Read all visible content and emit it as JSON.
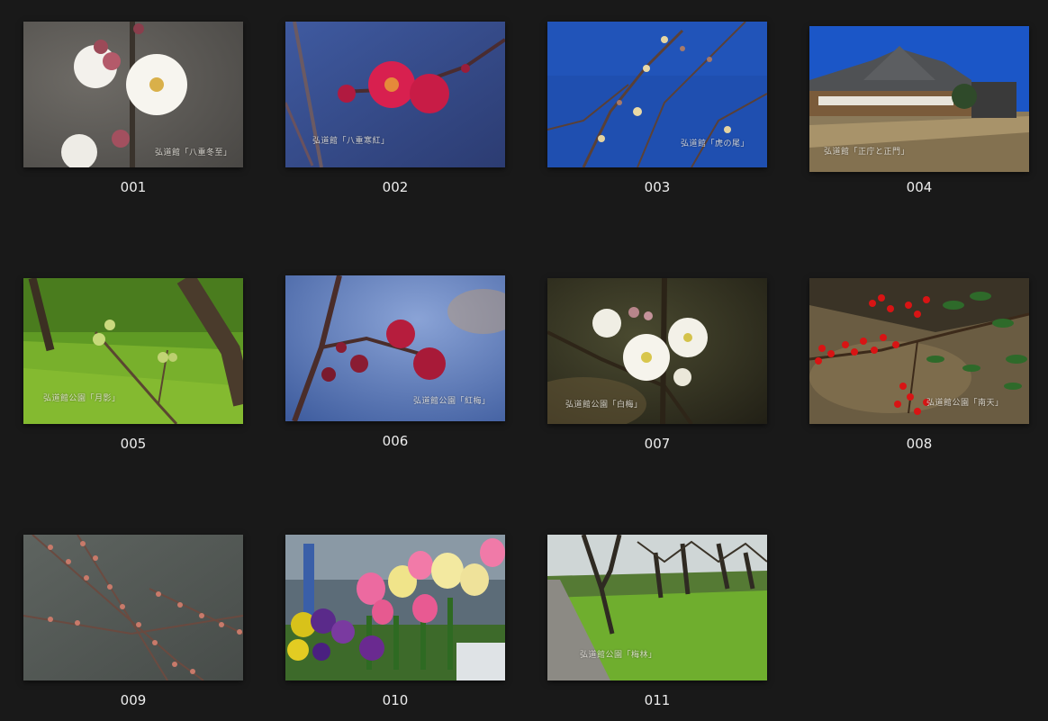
{
  "theme": {
    "background": "#191919",
    "label_color": "#ececec"
  },
  "gallery": {
    "items": [
      {
        "label": "001",
        "caption": "弘道館「八重冬至」",
        "subject": "white-plum-blossom"
      },
      {
        "label": "002",
        "caption": "弘道館「八重寒紅」",
        "subject": "red-plum-blossom"
      },
      {
        "label": "003",
        "caption": "弘道館「虎の尾」",
        "subject": "plum-buds-blue-sky"
      },
      {
        "label": "004",
        "caption": "弘道館「正庁と正門」",
        "subject": "kodokan-building"
      },
      {
        "label": "005",
        "caption": "弘道館公園「月影」",
        "subject": "green-buds-lawn"
      },
      {
        "label": "006",
        "caption": "弘道館公園「紅梅」",
        "subject": "red-buds-blue"
      },
      {
        "label": "007",
        "caption": "弘道館公園「白梅」",
        "subject": "white-blossom-dark"
      },
      {
        "label": "008",
        "caption": "弘道館公園「南天」",
        "subject": "nandina-berries"
      },
      {
        "label": "009",
        "caption": "",
        "subject": "pink-buds-grey"
      },
      {
        "label": "010",
        "caption": "",
        "subject": "tulips-pansies"
      },
      {
        "label": "011",
        "caption": "弘道館公園「梅林」",
        "subject": "plum-grove"
      }
    ]
  }
}
